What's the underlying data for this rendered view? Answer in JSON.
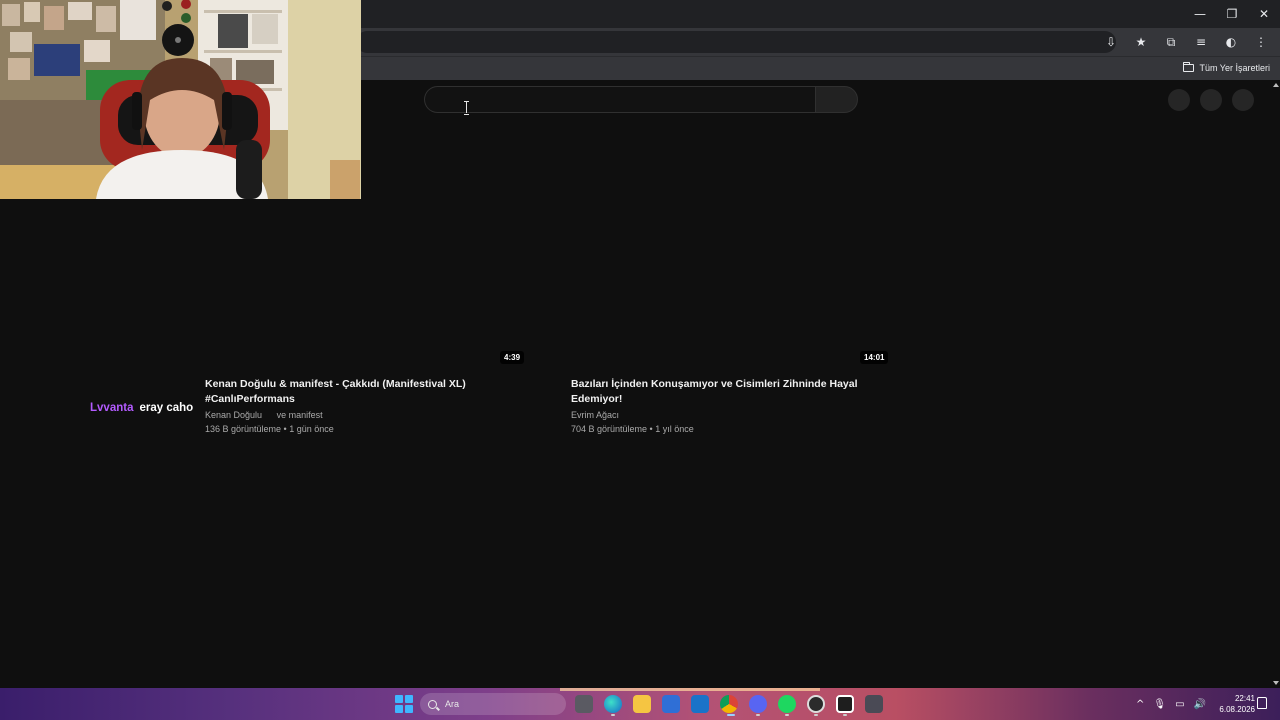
{
  "browser": {
    "window_controls": {
      "minimize": "—",
      "restore": "❐",
      "close": "✕"
    },
    "toolbar_icons": [
      "install-app-icon",
      "bookmark-star-icon",
      "extensions-icon",
      "media-control-icon",
      "profile-icon",
      "menu-icon"
    ],
    "toolbar_glyphs": [
      "⇩",
      "★",
      "⧉",
      "≡",
      "◐",
      "⋮"
    ],
    "bookmarks_label": "Tüm Yer İşaretleri"
  },
  "page": {
    "search": {
      "value": "",
      "placeholder": ""
    },
    "videos": [
      {
        "duration": "4:39",
        "title": "Kenan Doğulu & manifest - Çakkıdı (Manifestival XL) #CanlıPerformans",
        "channel": "Kenan Doğulu",
        "channel_extra": "ve manifest",
        "stats": "136 B görüntüleme • 1 gün önce"
      },
      {
        "duration": "14:01",
        "title": "Bazıları İçinden Konuşamıyor ve Cisimleri Zihninde Hayal Edemiyor!",
        "channel": "Evrim Ağacı",
        "channel_extra": "",
        "stats": "704 B görüntüleme • 1 yıl önce"
      }
    ]
  },
  "stream_overlay": {
    "name1": "Lvvanta",
    "name2": "eray caho",
    "name1_color": "#b35bff",
    "name2_color": "#ffffff"
  },
  "taskbar": {
    "search_label": "Ara",
    "apps": [
      "task-view-icon",
      "edge-icon",
      "file-explorer-icon",
      "store-icon",
      "outlook-icon",
      "chrome-icon",
      "discord-icon",
      "spotify-icon",
      "obs-icon",
      "app-icon",
      "calculator-icon"
    ],
    "time": "22:41",
    "date": "6.08.2026",
    "tray_glyphs": [
      "^",
      "🎙",
      "▭",
      "🔊"
    ]
  }
}
